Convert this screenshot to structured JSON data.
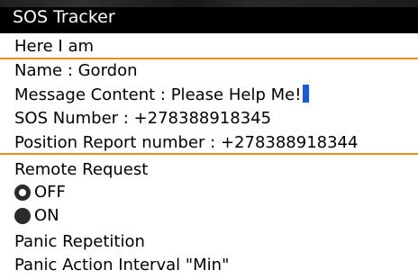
{
  "app": {
    "title": "SOS Tracker"
  },
  "status_line": "Here I am",
  "fields": {
    "name": "Name : Gordon",
    "message": "Message Content : Please Help Me!",
    "sos_number": "SOS Number :  +278388918345",
    "position_report": "Position Report number :  +278388918344"
  },
  "remote_request": {
    "label": "Remote Request",
    "options": [
      {
        "label": "OFF",
        "selected": true
      },
      {
        "label": "ON",
        "selected": false
      }
    ]
  },
  "panic": {
    "repetition": "Panic Repetition",
    "interval": "Panic Action Interval \"Min\""
  },
  "colors": {
    "focus_border": "#f08a1c",
    "cursor": "#1a5ad1",
    "titlebar": "#000000"
  }
}
